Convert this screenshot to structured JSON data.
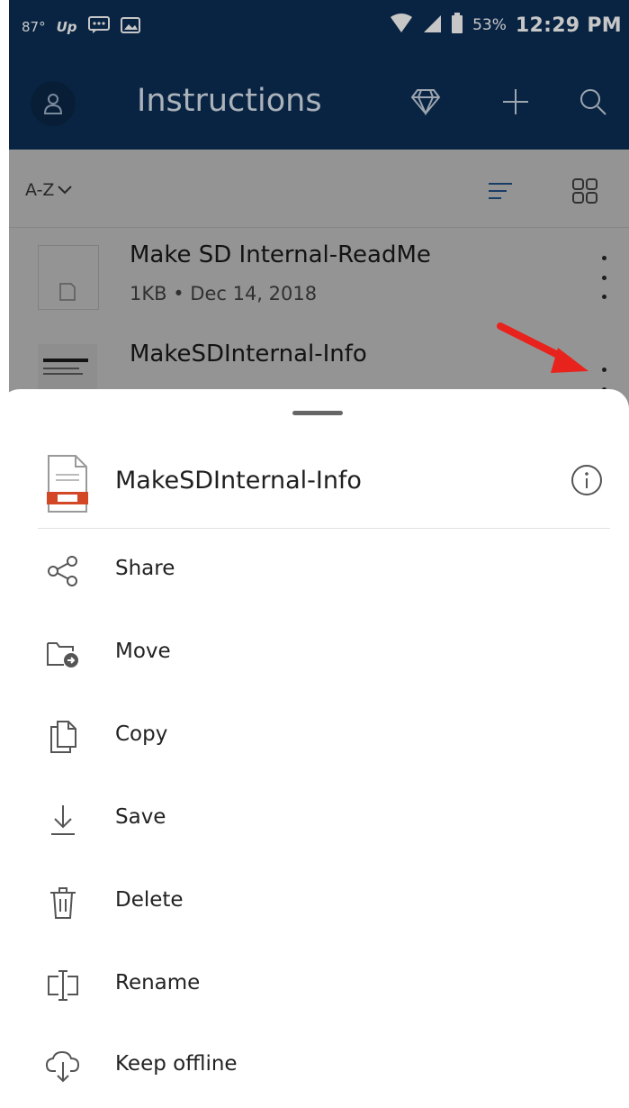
{
  "status_bar": {
    "temperature": "87°",
    "carrier": "Up",
    "battery": "53%",
    "time": "12:29 PM"
  },
  "app_bar": {
    "title": "Instructions"
  },
  "list": {
    "sort_label": "A-Z",
    "files": [
      {
        "name": "Make SD Internal-ReadMe",
        "meta": "1KB • Dec 14, 2018"
      },
      {
        "name": "MakeSDInternal-Info",
        "meta": ""
      }
    ]
  },
  "sheet": {
    "file_name": "MakeSDInternal-Info",
    "actions": [
      {
        "label": "Share",
        "icon": "share-icon"
      },
      {
        "label": "Move",
        "icon": "move-folder-icon"
      },
      {
        "label": "Copy",
        "icon": "copy-icon"
      },
      {
        "label": "Save",
        "icon": "download-icon"
      },
      {
        "label": "Delete",
        "icon": "trash-icon"
      },
      {
        "label": "Rename",
        "icon": "rename-icon"
      },
      {
        "label": "Keep offline",
        "icon": "cloud-download-icon"
      }
    ]
  },
  "colors": {
    "app_bar": "#0c2f57",
    "annotation_arrow": "#e8231d",
    "doc_icon_accent": "#d24726"
  }
}
